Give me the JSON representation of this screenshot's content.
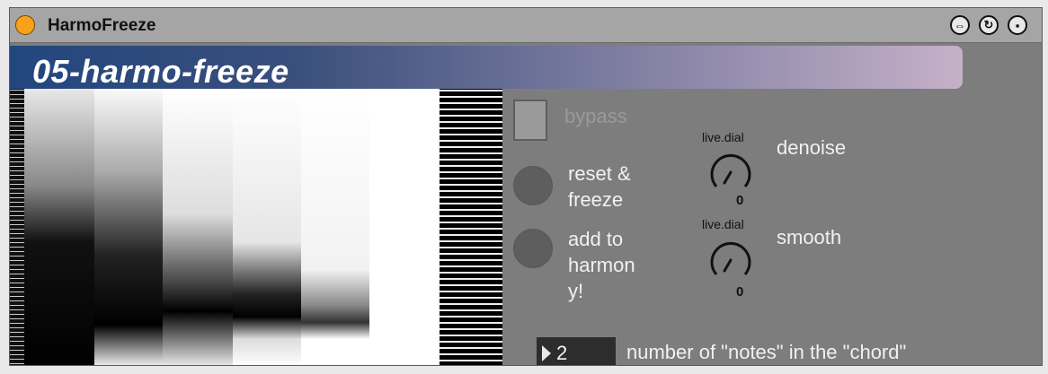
{
  "device": {
    "name": "HarmoFreeze",
    "power_color": "#f7a21a",
    "titlebar_icons": [
      "hotswap-icon",
      "reload-icon",
      "save-icon"
    ]
  },
  "banner": {
    "title": "05-harmo-freeze",
    "gradient": [
      "#22467e",
      "#c5b0c8"
    ]
  },
  "spectrogram": {
    "columns": 8,
    "notes": "visual spectral freeze display"
  },
  "controls": {
    "bypass_label": "bypass",
    "reset_label_1": "reset &",
    "reset_label_2": "freeze",
    "add_label_1": "add to",
    "add_label_2": "harmon",
    "add_label_3": "y!",
    "dial1": {
      "caption": "live.dial",
      "label": "denoise",
      "value": "0"
    },
    "dial2": {
      "caption": "live.dial",
      "label": "smooth",
      "value": "0"
    },
    "notes_number": "2",
    "notes_label": "number of \"notes\" in the \"chord\""
  }
}
